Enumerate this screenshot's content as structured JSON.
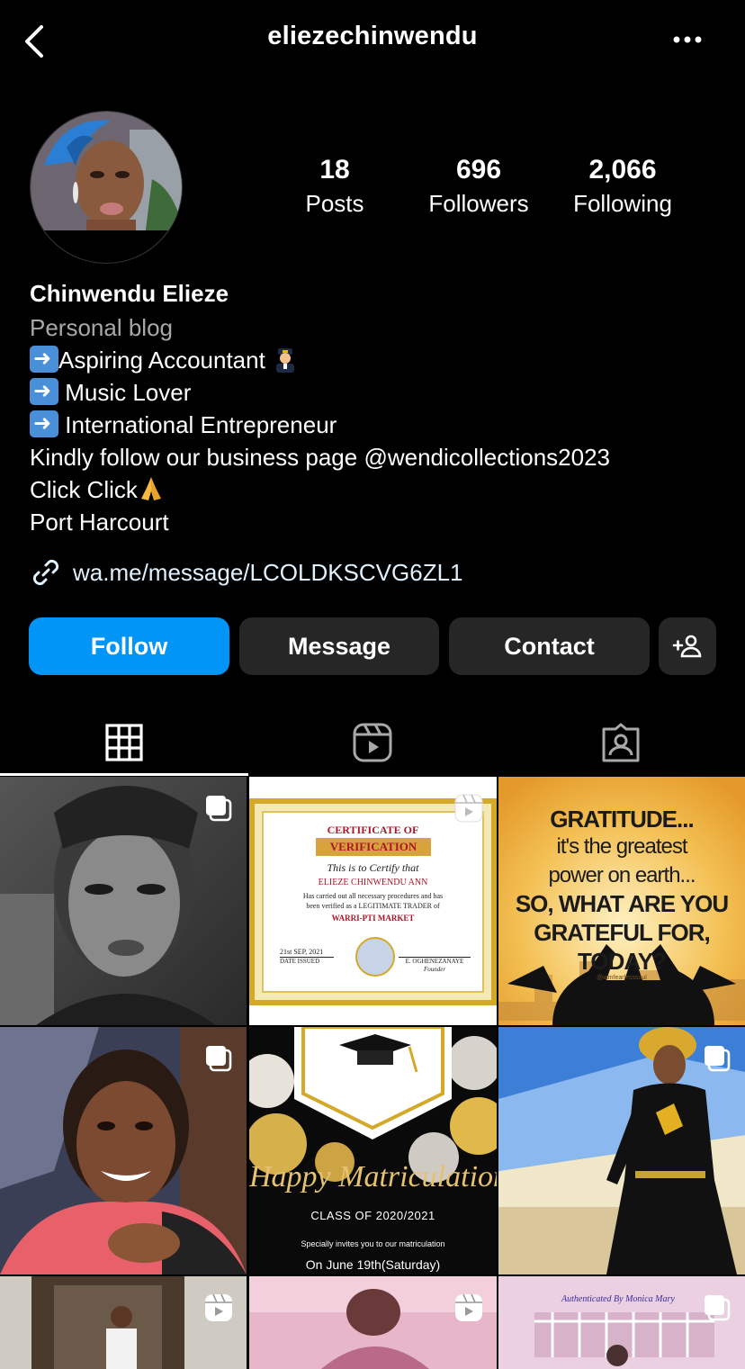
{
  "header": {
    "username": "eliezechinwendu"
  },
  "stats": [
    {
      "count": "18",
      "label": "Posts"
    },
    {
      "count": "696",
      "label": "Followers"
    },
    {
      "count": "2,066",
      "label": "Following"
    }
  ],
  "bio": {
    "name": "Chinwendu Elieze",
    "category": "Personal blog",
    "lines": [
      "Aspiring Accountant ",
      " Music Lover",
      " International Entrepreneur",
      "Kindly follow our business page @wendicollections2023",
      "Click Click",
      "Port Harcourt"
    ],
    "link": "wa.me/message/LCOLDKSCVG6ZL1"
  },
  "buttons": {
    "follow": "Follow",
    "message": "Message",
    "contact": "Contact"
  },
  "posts": [
    {
      "kind": "carousel"
    },
    {
      "kind": "reel",
      "certificate": {
        "title": "CERTIFICATE OF",
        "banner": "VERIFICATION",
        "certify": "This is to Certify that",
        "name": "ELIEZE CHINWENDU ANN",
        "body1": "Has carried out all necessary procedures and has",
        "body2": "been verified as a LEGITIMATE TRADER of",
        "market": "WARRI-PTI MARKET",
        "date": "21st SEP, 2021",
        "date_label": "DATE ISSUED",
        "signer": "E. OGHENEZANAYE",
        "signer_role": "Founder"
      }
    },
    {
      "kind": "image",
      "quote": {
        "l1": "GRATITUDE...",
        "l2": "it's the greatest",
        "l3": "power on earth...",
        "l4": "SO, WHAT ARE YOU",
        "l5": "GRATEFUL FOR,",
        "l6": "TODAY?",
        "credit": "@iamfearlesssoul"
      }
    },
    {
      "kind": "carousel"
    },
    {
      "kind": "image",
      "matric": {
        "script": "Happy Matriculation",
        "class": "CLASS OF 2020/2021",
        "invite": "Specially invites you to our matriculation",
        "date": "On June 19th(Saturday)"
      }
    },
    {
      "kind": "carousel"
    },
    {
      "kind": "reel"
    },
    {
      "kind": "reel"
    },
    {
      "kind": "carousel",
      "caption": "Authenticated By Monica Mary"
    }
  ],
  "colors": {
    "accent": "#0095f6",
    "button_dark": "#262626",
    "secondary_text": "#a8a8a8",
    "link_text": "#e0f1ff"
  }
}
